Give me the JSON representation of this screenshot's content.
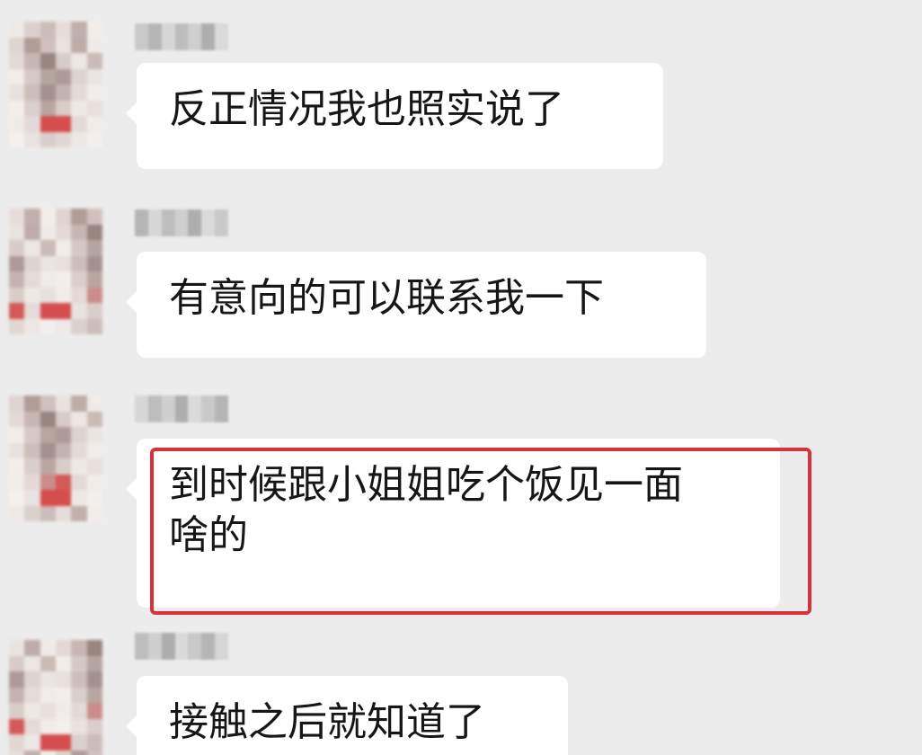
{
  "chat": {
    "messages": [
      {
        "text": "反正情况我也照实说了"
      },
      {
        "text": "有意向的可以联系我一下"
      },
      {
        "text_line1": "到时候跟小姐姐吃个饭见一面",
        "text_line2": "啥的"
      },
      {
        "text": "接触之后就知道了"
      }
    ]
  },
  "colors": {
    "background": "#ececec",
    "bubble": "#ffffff",
    "highlight_border": "#d9333a",
    "text": "#161616"
  }
}
